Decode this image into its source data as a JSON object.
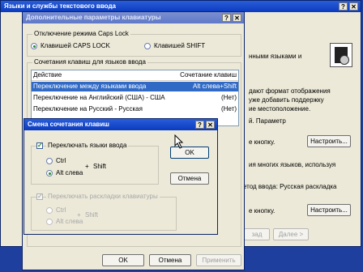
{
  "back_window": {
    "title": "Языки и службы текстового ввода",
    "texts": [
      "нными языками и",
      "дают формат отображения",
      "уже добавить поддержку",
      "ие местоположение.",
      "й. Параметр",
      "е кнопку.",
      "ия многих языков, используя",
      "етод ввода: Русская раскладка",
      "е кнопку."
    ],
    "settings_button_1": "Настроить...",
    "settings_button_2": "Настроить...",
    "back_button": "зад",
    "next_button": "Далее >"
  },
  "advanced_dialog": {
    "title": "Дополнительные параметры клавиатуры",
    "caps_group": "Отключение режима Caps Lock",
    "caps_option_1": "Клавишей CAPS LOCK",
    "caps_option_2": "Клавишей SHIFT",
    "hotkeys_group": "Сочетания клавиш для языков ввода",
    "col_action": "Действие",
    "col_keys": "Сочетание клавиш",
    "rows": [
      {
        "action": "Переключение между языками ввода",
        "keys": "Alt слева+Shift"
      },
      {
        "action": "Переключение на Английский (США) - США",
        "keys": "(Нет)"
      },
      {
        "action": "Переключение на Русский - Русская",
        "keys": "(Нет)"
      }
    ],
    "ok_button": "OK",
    "cancel_button": "Отмена",
    "apply_button": "Применить"
  },
  "change_dialog": {
    "title": "Смена сочетания клавиш",
    "switch_input_label": "Переключать языки ввода",
    "ctrl_label": "Ctrl",
    "left_alt_label": "Alt слева",
    "plus": "+",
    "shift_label": "Shift",
    "switch_layout_label": "Переключать раскладки клавиатуры",
    "ctrl_label_2": "Ctrl",
    "left_alt_label_2": "Alt слева",
    "shift_label_2": "Shift",
    "ok_button": "OK",
    "cancel_button": "Отмена"
  }
}
